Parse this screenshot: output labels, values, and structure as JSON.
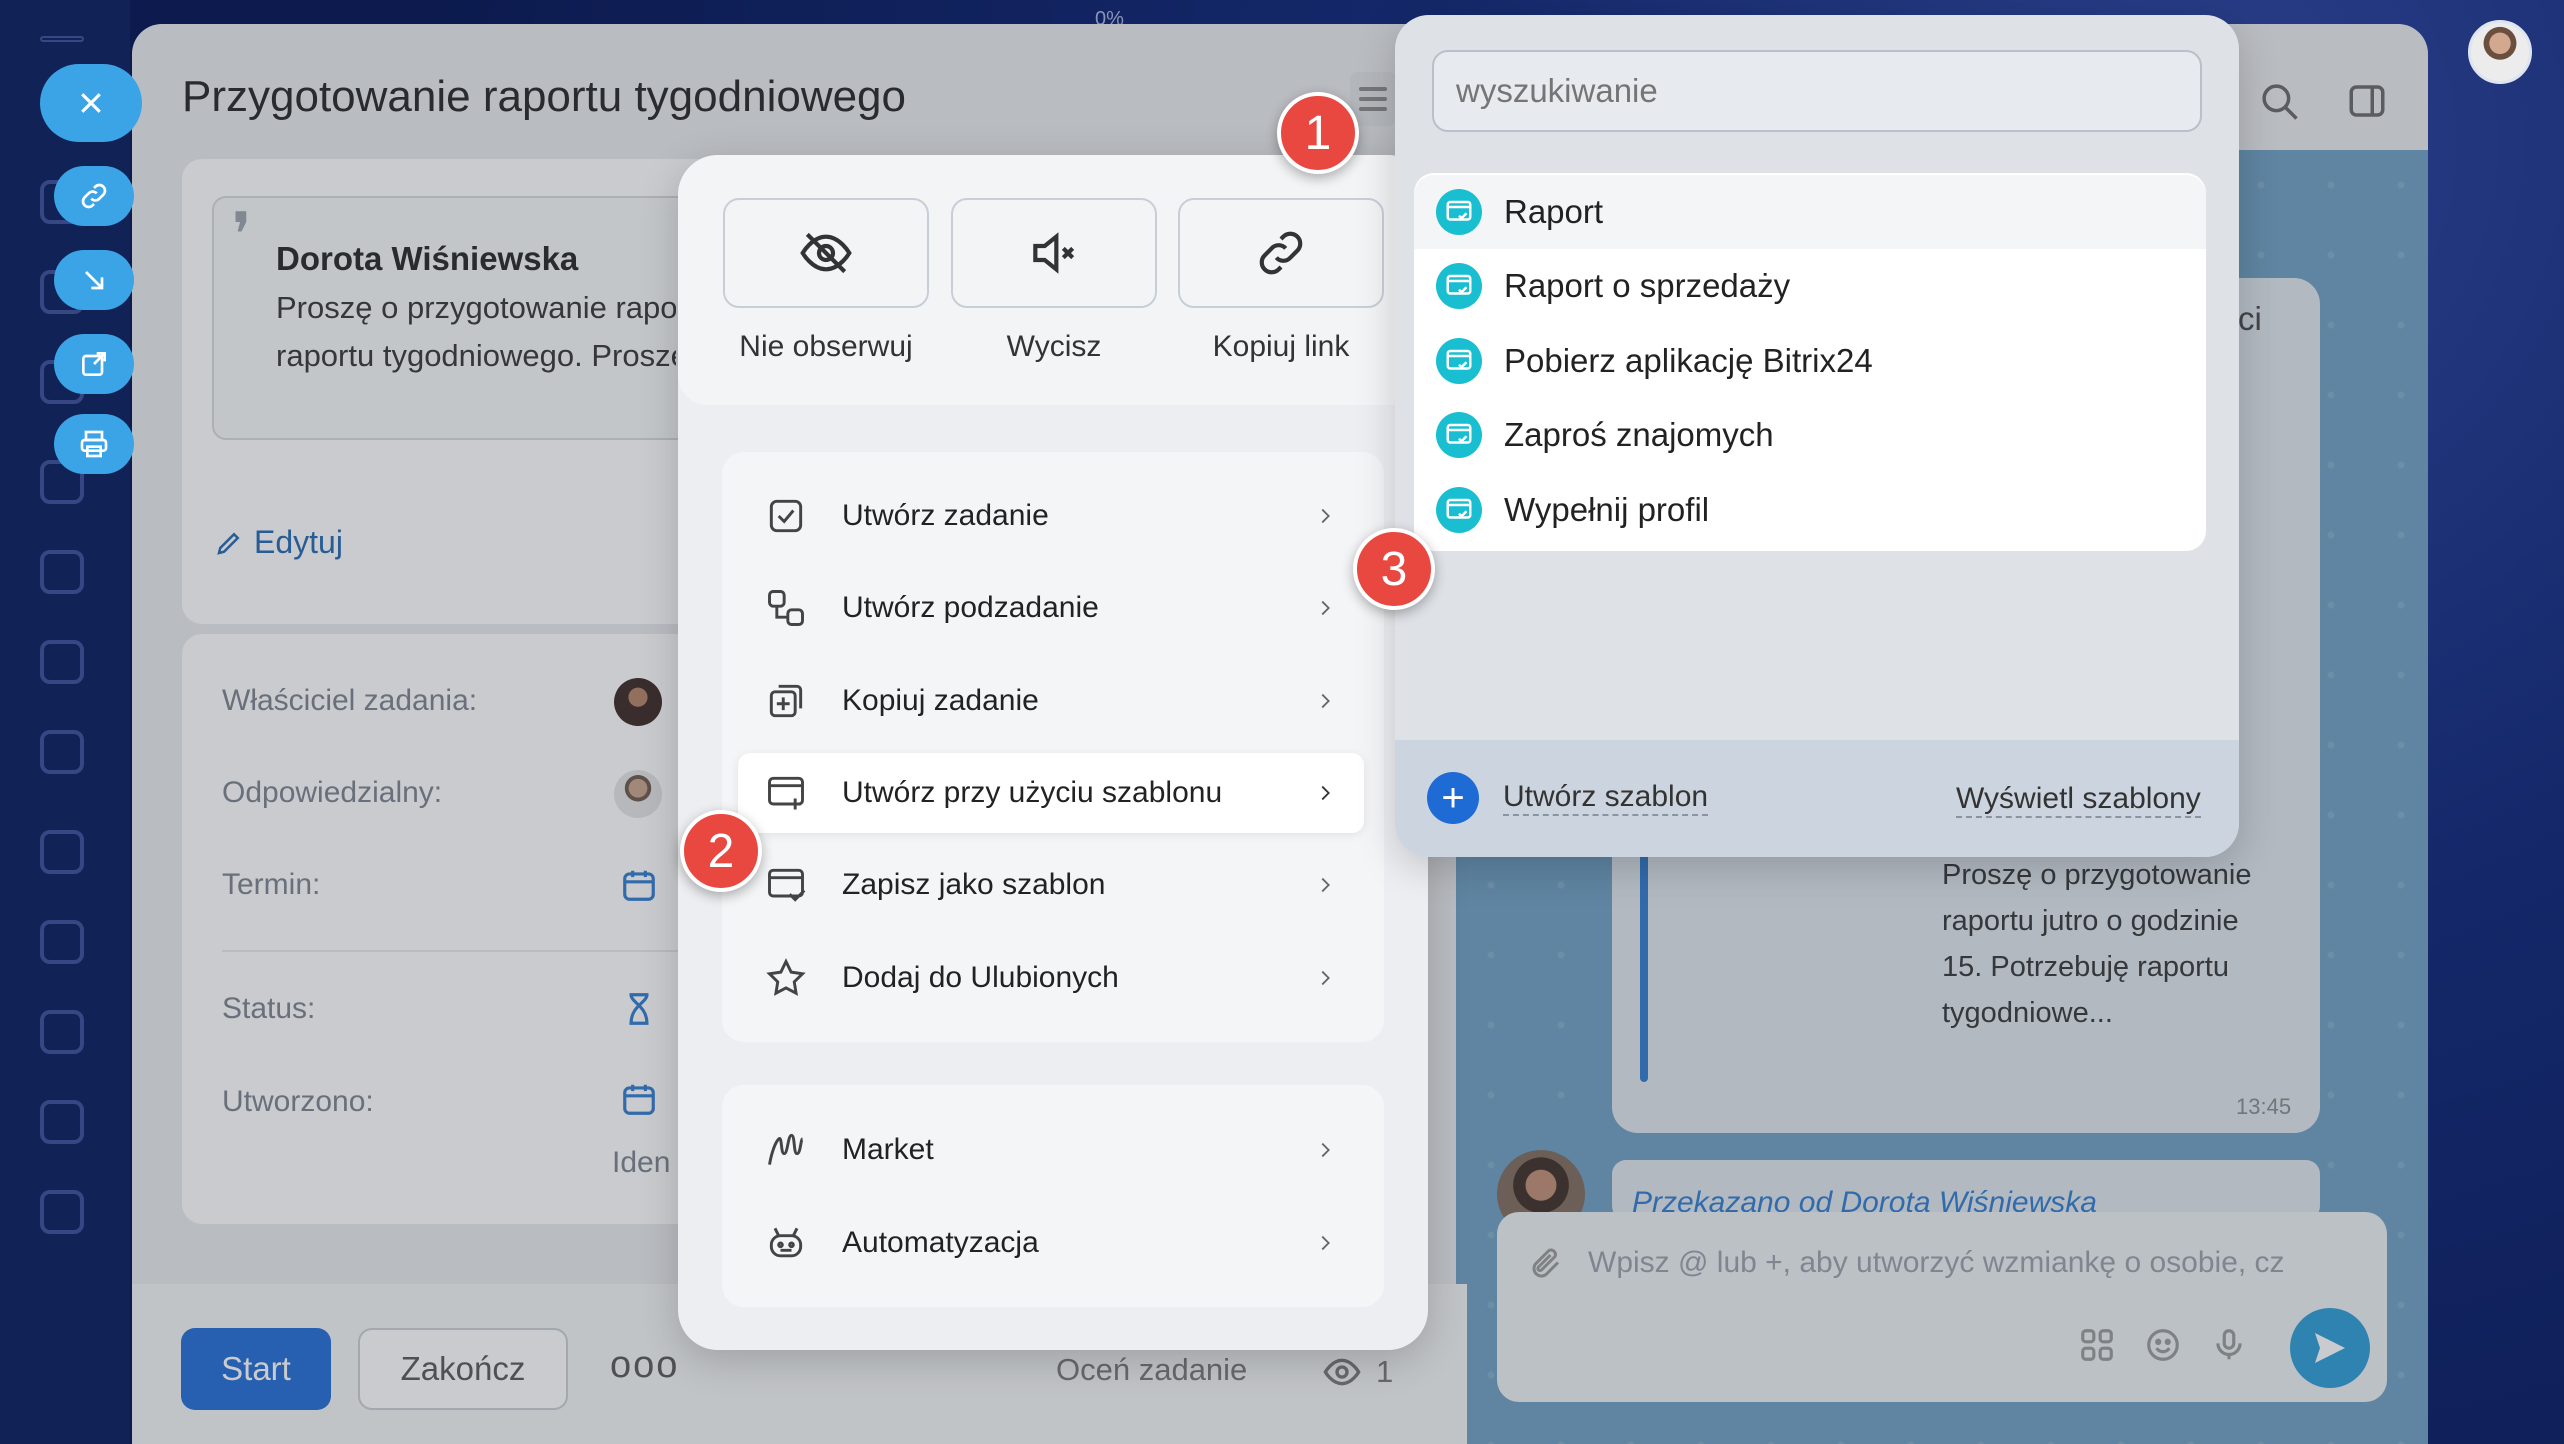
{
  "task": {
    "title": "Przygotowanie raportu tygodniowego",
    "percent": "0%",
    "author": "Dorota Wiśniewska",
    "description_line1": "Proszę o przygotowanie raportu",
    "description_line2": "raportu tygodniowego. Proszę",
    "edit_label": "Edytuj"
  },
  "fields": {
    "owner_label": "Właściciel zadania:",
    "responsible_label": "Odpowiedzialny:",
    "deadline_label": "Termin:",
    "status_label": "Status:",
    "created_label": "Utworzono:",
    "ident_label": "Iden"
  },
  "bottom": {
    "start": "Start",
    "finish": "Zakończ",
    "more": "ooo",
    "rate": "Oceń zadanie",
    "views": "1"
  },
  "quick_actions": [
    {
      "label": "Nie obserwuj",
      "icon": "eye-off-icon"
    },
    {
      "label": "Wycisz",
      "icon": "mute-icon"
    },
    {
      "label": "Kopiuj link",
      "icon": "link-icon"
    }
  ],
  "menu": {
    "items": [
      {
        "label": "Utwórz zadanie",
        "icon": "checkbox-icon"
      },
      {
        "label": "Utwórz podzadanie",
        "icon": "subtask-icon"
      },
      {
        "label": "Kopiuj zadanie",
        "icon": "copy-icon"
      },
      {
        "label": "Utwórz przy użyciu szablonu",
        "icon": "template-add-icon",
        "highlighted": true
      },
      {
        "label": "Zapisz jako szablon",
        "icon": "template-save-icon"
      },
      {
        "label": "Dodaj do Ulubionych",
        "icon": "star-icon"
      }
    ],
    "items2": [
      {
        "label": "Market",
        "icon": "market-icon"
      },
      {
        "label": "Automatyzacja",
        "icon": "robot-icon"
      }
    ]
  },
  "templates": {
    "search_placeholder": "wyszukiwanie",
    "items": [
      "Raport",
      "Raport o sprzedaży",
      "Pobierz aplikację Bitrix24",
      "Zaproś znajomych",
      "Wypełnij profil"
    ],
    "create_label": "Utwórz szablon",
    "view_label": "Wyświetl szablony"
  },
  "chat": {
    "message_tail": "ci",
    "message": "Proszę o przygotowanie raportu jutro o godzinie 15. Potrzebuję raportu tygodniowe...",
    "time": "13:45",
    "forwarded": "Przekazano od Dorota Wiśniewska",
    "composer_placeholder": "Wpisz @ lub +, aby utworzyć wzmiankę o osobie, cz"
  },
  "callouts": [
    "1",
    "2",
    "3"
  ],
  "colors": {
    "accent": "#1f6bd6",
    "callout": "#e8483f",
    "template_icon": "#19bfd1"
  }
}
